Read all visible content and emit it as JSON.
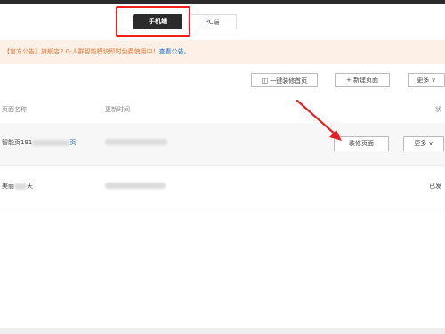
{
  "tabs": {
    "mobile": "手机端",
    "pc": "PC端"
  },
  "notice": {
    "text": "【官方公告】旗舰店2.0-人群智能模块即时免费使用中！",
    "link": "查看公告。"
  },
  "toolbar": {
    "decorate_home": "一键装修首页",
    "new_page": "+ 新建页面",
    "more": "更多 ∨"
  },
  "table": {
    "headers": {
      "name": "页面名称",
      "updated": "更新时间",
      "status": "状"
    },
    "rows": [
      {
        "name_prefix": "智能页191",
        "name_suffix": "页",
        "edit": "装修页面",
        "more": "更多 ∨"
      },
      {
        "name_prefix": "美丽",
        "name_suffix": "天",
        "status": "已发"
      }
    ]
  },
  "colors": {
    "accent_red": "#e22222",
    "link_blue": "#1a73c8",
    "notice_bg": "#fdf0e7"
  }
}
